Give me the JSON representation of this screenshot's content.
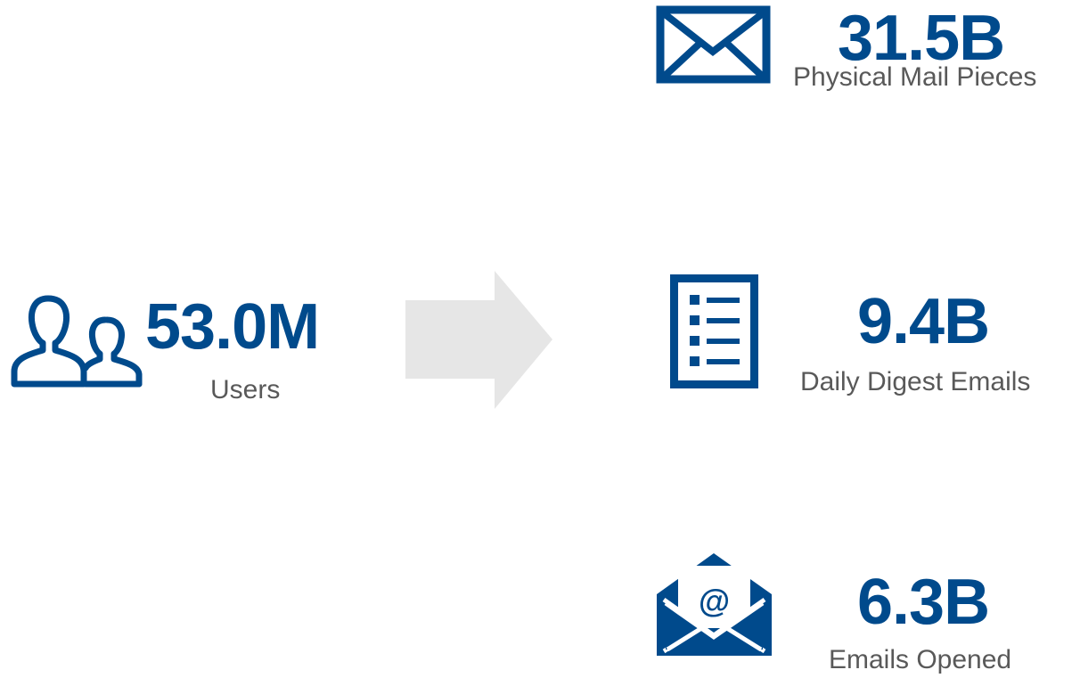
{
  "source": {
    "value": "53.0M",
    "label": "Users",
    "icon": "users-icon"
  },
  "arrow": {
    "icon": "right-arrow-icon",
    "color": "#e6e6e6"
  },
  "outputs": [
    {
      "value": "31.5B",
      "label": "Physical Mail Pieces",
      "icon": "envelope-icon"
    },
    {
      "value": "9.4B",
      "label": "Daily Digest Emails",
      "icon": "list-document-icon"
    },
    {
      "value": "6.3B",
      "label": "Emails Opened",
      "icon": "open-envelope-at-icon"
    }
  ],
  "colors": {
    "primary": "#004a8c",
    "label": "#595959",
    "arrow": "#e6e6e6",
    "background": "#ffffff"
  }
}
